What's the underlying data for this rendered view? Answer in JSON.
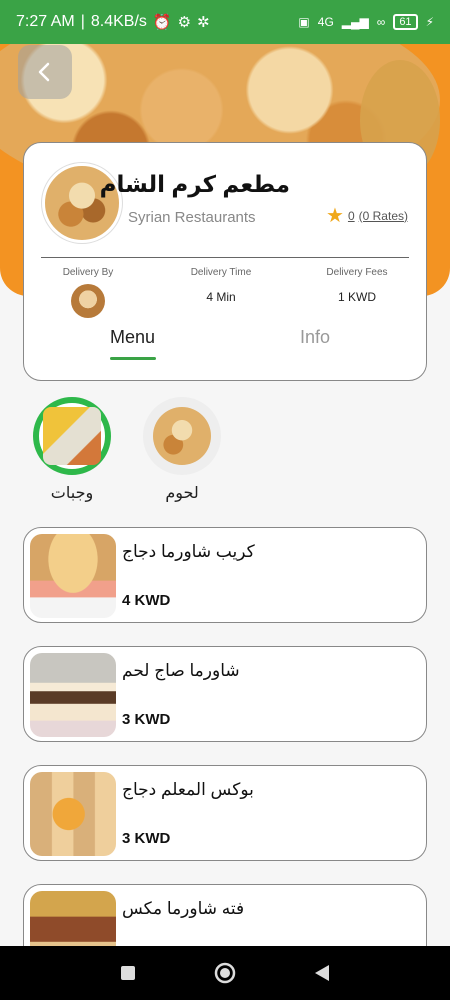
{
  "status_bar": {
    "time": "7:27 AM",
    "speed": "8.4KB/s",
    "network": "4G",
    "battery": "61"
  },
  "restaurant": {
    "name": "مطعم كرم الشام",
    "category": "Syrian Restaurants",
    "rating_value": "0",
    "rating_count": "(0 Rates)",
    "delivery_by_label": "Delivery By",
    "delivery_time_label": "Delivery Time",
    "delivery_time_value": "4 Min",
    "delivery_fees_label": "Delivery Fees",
    "delivery_fees_value": "1 KWD"
  },
  "tabs": [
    {
      "label": "Menu",
      "active": true
    },
    {
      "label": "Info",
      "active": false
    }
  ],
  "categories": [
    {
      "label": "وجبات",
      "active": true
    },
    {
      "label": "لحوم",
      "active": false
    }
  ],
  "menu_items": [
    {
      "name": "كريب شاورما دجاج",
      "price": "4 KWD"
    },
    {
      "name": "شاورما صاج لحم",
      "price": "3 KWD"
    },
    {
      "name": "بوكس المعلم دجاج",
      "price": "3 KWD"
    },
    {
      "name": "فته شاورما مكس",
      "price": ""
    }
  ],
  "colors": {
    "status_bar": "#3aa346",
    "accent_green": "#2eb84a",
    "hero_orange": "#f39322",
    "star": "#f0a81a"
  }
}
